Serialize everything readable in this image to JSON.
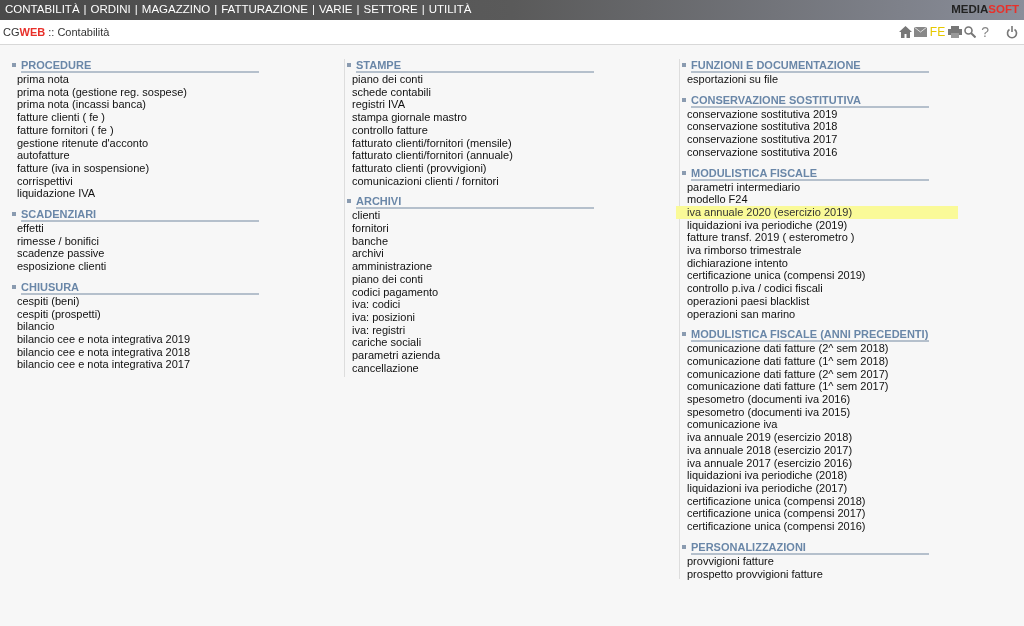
{
  "menu_bar": {
    "items": [
      "CONTABILITÀ",
      "ORDINI",
      "MAGAZZINO",
      "FATTURAZIONE",
      "VARIE",
      "SETTORE",
      "UTILITÀ"
    ],
    "separator": "|",
    "brand": {
      "part1": "MEDIA",
      "part2": "SOFT"
    }
  },
  "header": {
    "app": {
      "part1": "CG",
      "part2": "WEB"
    },
    "separator": "::",
    "title": "Contabilità",
    "toolbar": [
      {
        "kind": "home"
      },
      {
        "kind": "mail"
      },
      {
        "kind": "text",
        "text": "FE"
      },
      {
        "kind": "print"
      },
      {
        "kind": "search"
      },
      {
        "kind": "help",
        "text": "?"
      },
      {
        "kind": "power"
      }
    ]
  },
  "columns": [
    [
      {
        "title": "PROCEDURE",
        "items": [
          {
            "label": "prima nota",
            "selected": false
          },
          {
            "label": "prima nota (gestione reg. sospese)",
            "selected": false
          },
          {
            "label": "prima nota (incassi banca)",
            "selected": false
          },
          {
            "label": "fatture clienti ( fe )",
            "selected": false
          },
          {
            "label": "fatture fornitori ( fe )",
            "selected": false
          },
          {
            "label": "gestione ritenute d'acconto",
            "selected": false
          },
          {
            "label": "autofatture",
            "selected": false
          },
          {
            "label": "fatture (iva in sospensione)",
            "selected": false
          },
          {
            "label": "corrispettivi",
            "selected": false
          },
          {
            "label": "liquidazione IVA",
            "selected": false
          }
        ]
      },
      {
        "title": "SCADENZIARI",
        "items": [
          {
            "label": "effetti",
            "selected": false
          },
          {
            "label": "rimesse / bonifici",
            "selected": false
          },
          {
            "label": "scadenze passive",
            "selected": false
          },
          {
            "label": "esposizione clienti",
            "selected": false
          }
        ]
      },
      {
        "title": "CHIUSURA",
        "items": [
          {
            "label": "cespiti (beni)",
            "selected": false
          },
          {
            "label": "cespiti (prospetti)",
            "selected": false
          },
          {
            "label": "bilancio",
            "selected": false
          },
          {
            "label": "bilancio cee e nota integrativa 2019",
            "selected": false
          },
          {
            "label": "bilancio cee e nota integrativa 2018",
            "selected": false
          },
          {
            "label": "bilancio cee e nota integrativa 2017",
            "selected": false
          }
        ]
      }
    ],
    [
      {
        "title": "STAMPE",
        "items": [
          {
            "label": "piano dei conti",
            "selected": false
          },
          {
            "label": "schede contabili",
            "selected": false
          },
          {
            "label": "registri IVA",
            "selected": false
          },
          {
            "label": "stampa giornale mastro",
            "selected": false
          },
          {
            "label": "controllo fatture",
            "selected": false
          },
          {
            "label": "fatturato clienti/fornitori (mensile)",
            "selected": false
          },
          {
            "label": "fatturato clienti/fornitori (annuale)",
            "selected": false
          },
          {
            "label": "fatturato clienti (provvigioni)",
            "selected": false
          },
          {
            "label": "comunicazioni clienti / fornitori",
            "selected": false
          }
        ]
      },
      {
        "title": "ARCHIVI",
        "items": [
          {
            "label": "clienti",
            "selected": false
          },
          {
            "label": "fornitori",
            "selected": false
          },
          {
            "label": "banche",
            "selected": false
          },
          {
            "label": "archivi",
            "selected": false
          },
          {
            "label": "amministrazione",
            "selected": false
          },
          {
            "label": "piano dei conti",
            "selected": false
          },
          {
            "label": "codici pagamento",
            "selected": false
          },
          {
            "label": "iva: codici",
            "selected": false
          },
          {
            "label": "iva: posizioni",
            "selected": false
          },
          {
            "label": "iva: registri",
            "selected": false
          },
          {
            "label": "cariche sociali",
            "selected": false
          },
          {
            "label": "parametri azienda",
            "selected": false
          },
          {
            "label": "cancellazione",
            "selected": false
          }
        ]
      }
    ],
    [
      {
        "title": "FUNZIONI E DOCUMENTAZIONE",
        "items": [
          {
            "label": "esportazioni su file",
            "selected": false
          }
        ]
      },
      {
        "title": "CONSERVAZIONE SOSTITUTIVA",
        "items": [
          {
            "label": "conservazione sostitutiva 2019",
            "selected": false
          },
          {
            "label": "conservazione sostitutiva 2018",
            "selected": false
          },
          {
            "label": "conservazione sostitutiva 2017",
            "selected": false
          },
          {
            "label": "conservazione sostitutiva 2016",
            "selected": false
          }
        ]
      },
      {
        "title": "MODULISTICA FISCALE",
        "items": [
          {
            "label": "parametri intermediario",
            "selected": false
          },
          {
            "label": "modello F24",
            "selected": false
          },
          {
            "label": "iva annuale 2020 (esercizio 2019)",
            "selected": true
          },
          {
            "label": "liquidazioni iva periodiche (2019)",
            "selected": false
          },
          {
            "label": "fatture transf. 2019 ( esterometro )",
            "selected": false
          },
          {
            "label": "iva rimborso trimestrale",
            "selected": false
          },
          {
            "label": "dichiarazione intento",
            "selected": false
          },
          {
            "label": "certificazione unica (compensi 2019)",
            "selected": false
          },
          {
            "label": "controllo p.iva / codici fiscali",
            "selected": false
          },
          {
            "label": "operazioni paesi blacklist",
            "selected": false
          },
          {
            "label": "operazioni san marino",
            "selected": false
          }
        ]
      },
      {
        "title": "MODULISTICA FISCALE (ANNI PRECEDENTI)",
        "items": [
          {
            "label": "comunicazione dati fatture (2^ sem 2018)",
            "selected": false
          },
          {
            "label": "comunicazione dati fatture (1^ sem 2018)",
            "selected": false
          },
          {
            "label": "comunicazione dati fatture (2^ sem 2017)",
            "selected": false
          },
          {
            "label": "comunicazione dati fatture (1^ sem 2017)",
            "selected": false
          },
          {
            "label": "spesometro (documenti iva 2016)",
            "selected": false
          },
          {
            "label": "spesometro (documenti iva 2015)",
            "selected": false
          },
          {
            "label": "comunicazione iva",
            "selected": false
          },
          {
            "label": "iva annuale 2019 (esercizio 2018)",
            "selected": false
          },
          {
            "label": "iva annuale 2018 (esercizio 2017)",
            "selected": false
          },
          {
            "label": "iva annuale 2017 (esercizio 2016)",
            "selected": false
          },
          {
            "label": "liquidazioni iva periodiche (2018)",
            "selected": false
          },
          {
            "label": "liquidazioni iva periodiche (2017)",
            "selected": false
          },
          {
            "label": "certificazione unica (compensi 2018)",
            "selected": false
          },
          {
            "label": "certificazione unica (compensi 2017)",
            "selected": false
          },
          {
            "label": "certificazione unica (compensi 2016)",
            "selected": false
          }
        ]
      },
      {
        "title": "PERSONALIZZAZIONI",
        "items": [
          {
            "label": "provvigioni fatture",
            "selected": false
          },
          {
            "label": "prospetto provvigioni fatture",
            "selected": false
          }
        ]
      }
    ]
  ]
}
